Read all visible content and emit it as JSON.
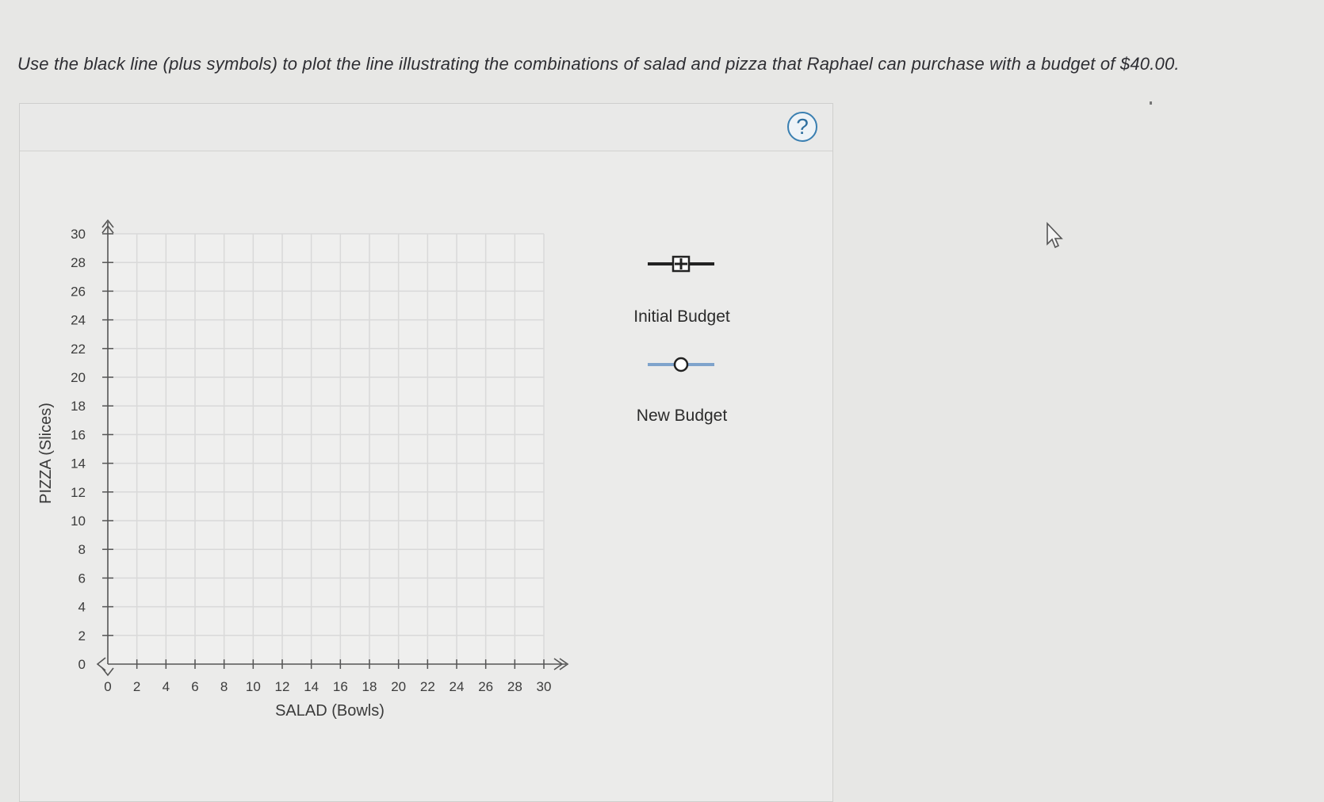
{
  "instruction": "Use the black line (plus symbols) to plot the line illustrating the combinations of salad and pizza that Raphael can purchase with a budget of $40.00.",
  "help_label": "?",
  "legend": {
    "initial": {
      "label": "Initial Budget",
      "color": "#222222",
      "marker": "plus-icon"
    },
    "new": {
      "label": "New Budget",
      "color": "#7fa3cc",
      "marker": "circle-icon"
    }
  },
  "chart_data": {
    "type": "line",
    "xlabel": "SALAD (Bowls)",
    "ylabel": "PIZZA (Slices)",
    "xlim": [
      0,
      30
    ],
    "ylim": [
      0,
      30
    ],
    "xticks": [
      0,
      2,
      4,
      6,
      8,
      10,
      12,
      14,
      16,
      18,
      20,
      22,
      24,
      26,
      28,
      30
    ],
    "yticks": [
      0,
      2,
      4,
      6,
      8,
      10,
      12,
      14,
      16,
      18,
      20,
      22,
      24,
      26,
      28,
      30
    ],
    "grid": true,
    "series": []
  }
}
